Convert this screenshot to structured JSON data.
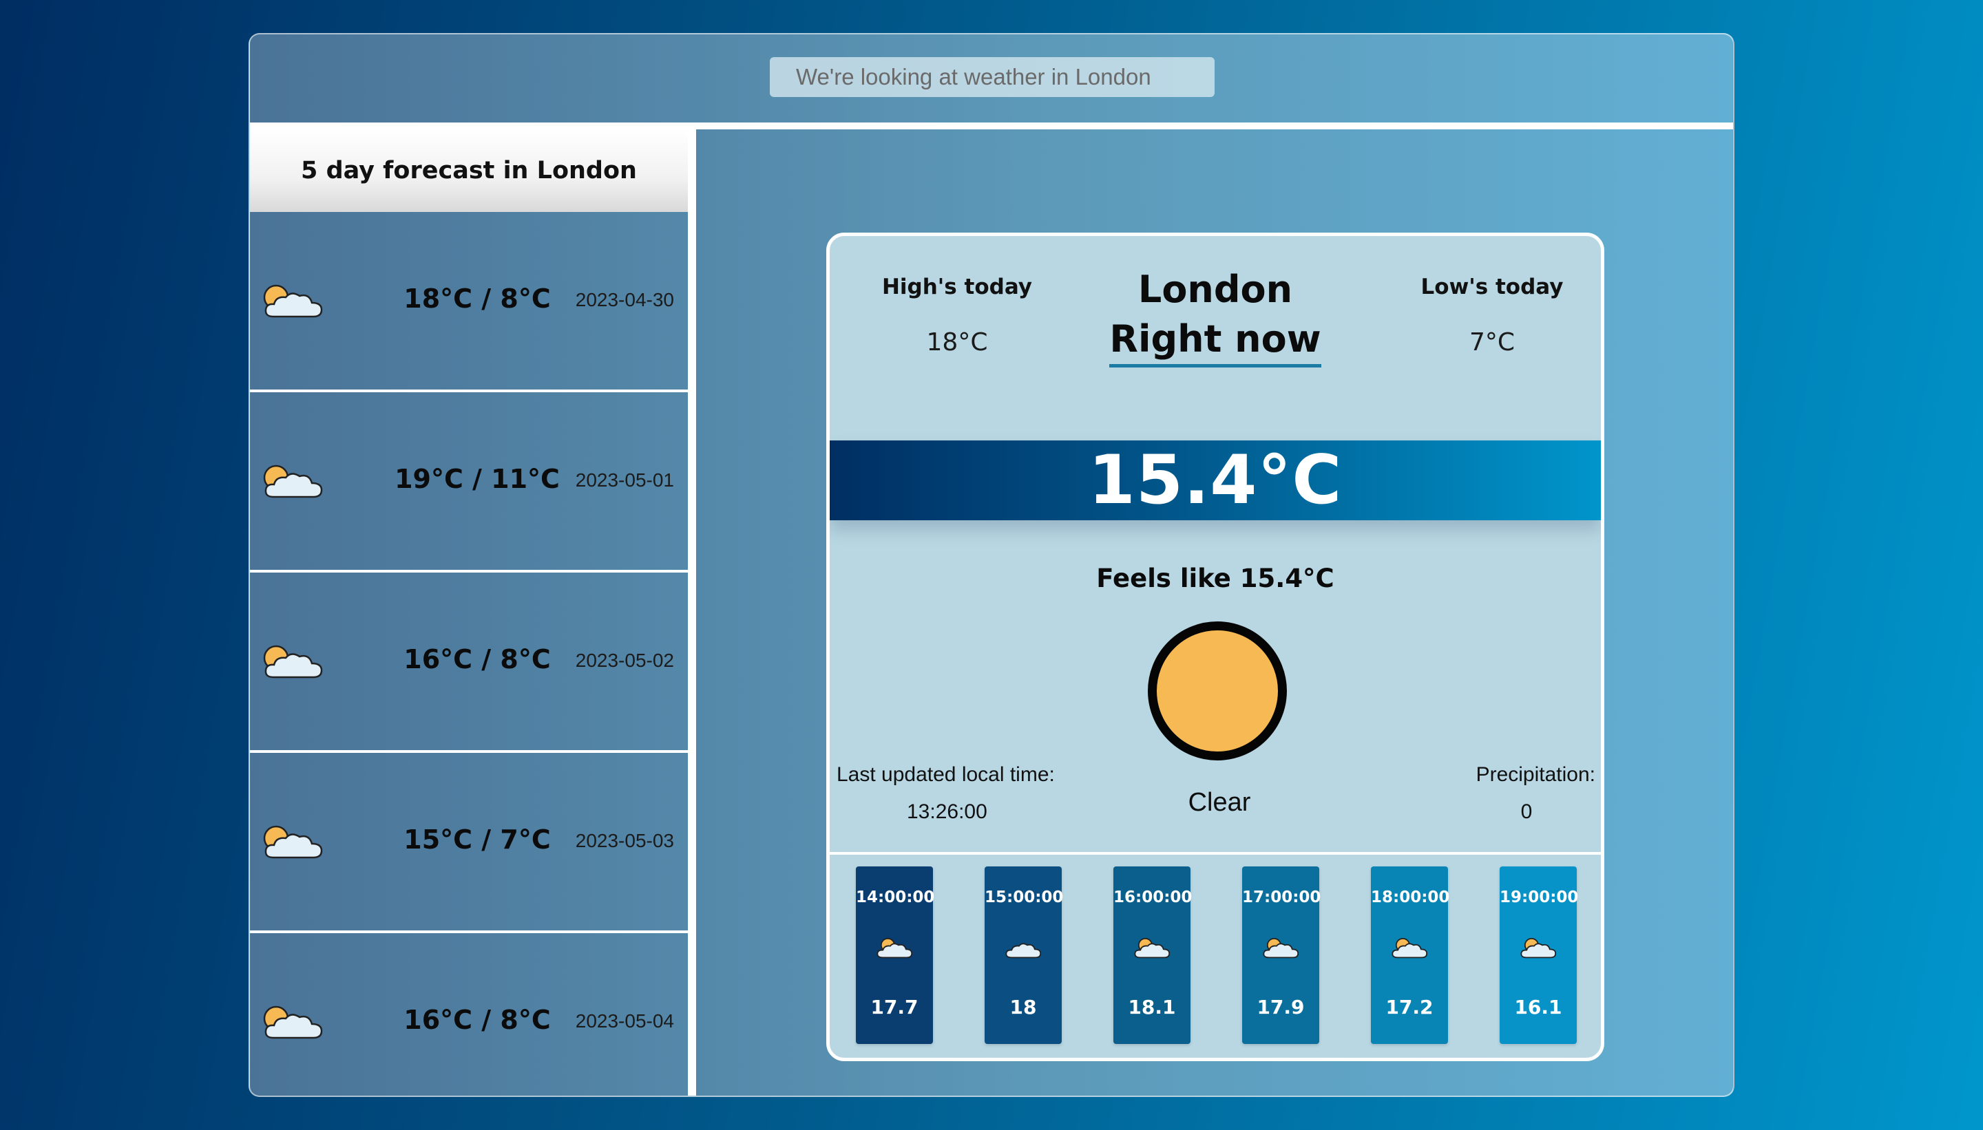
{
  "search": {
    "placeholder": "We're looking at weather in London"
  },
  "sidebar": {
    "title": "5 day forecast in London",
    "days": [
      {
        "temps": "18°C / 8°C",
        "date": "2023-04-30",
        "icon": "partly-cloudy-icon"
      },
      {
        "temps": "19°C / 11°C",
        "date": "2023-05-01",
        "icon": "partly-cloudy-icon"
      },
      {
        "temps": "16°C / 8°C",
        "date": "2023-05-02",
        "icon": "partly-cloudy-icon"
      },
      {
        "temps": "15°C / 7°C",
        "date": "2023-05-03",
        "icon": "partly-cloudy-icon"
      },
      {
        "temps": "16°C / 8°C",
        "date": "2023-05-04",
        "icon": "partly-cloudy-icon"
      }
    ]
  },
  "current": {
    "city": "London",
    "subtitle": "Right now",
    "high_label": "High's today",
    "high_value": "18°C",
    "low_label": "Low's today",
    "low_value": "7°C",
    "temperature": "15.4°C",
    "feels_like": "Feels like 15.4°C",
    "condition": "Clear",
    "condition_icon": "sun-icon",
    "updated_label": "Last updated local time:",
    "updated_value": "13:26:00",
    "precip_label": "Precipitation:",
    "precip_value": "0"
  },
  "hourly": [
    {
      "time": "14:00:00",
      "temp": "17.7",
      "icon": "partly-cloudy-icon",
      "color": "#0a3d70"
    },
    {
      "time": "15:00:00",
      "temp": "18",
      "icon": "cloud-icon",
      "color": "#0b4f82"
    },
    {
      "time": "16:00:00",
      "temp": "18.1",
      "icon": "partly-cloudy-icon",
      "color": "#0a5f8c"
    },
    {
      "time": "17:00:00",
      "temp": "17.9",
      "icon": "partly-cloudy-icon",
      "color": "#0a6f9d"
    },
    {
      "time": "18:00:00",
      "temp": "17.2",
      "icon": "partly-cloudy-icon",
      "color": "#0884b5"
    },
    {
      "time": "19:00:00",
      "temp": "16.1",
      "icon": "partly-cloudy-icon",
      "color": "#0893c8"
    }
  ],
  "colors": {
    "accent": "#1b7ba3",
    "sun": "#f6b954",
    "band_start": "#002f63",
    "band_end": "#0095cb"
  }
}
